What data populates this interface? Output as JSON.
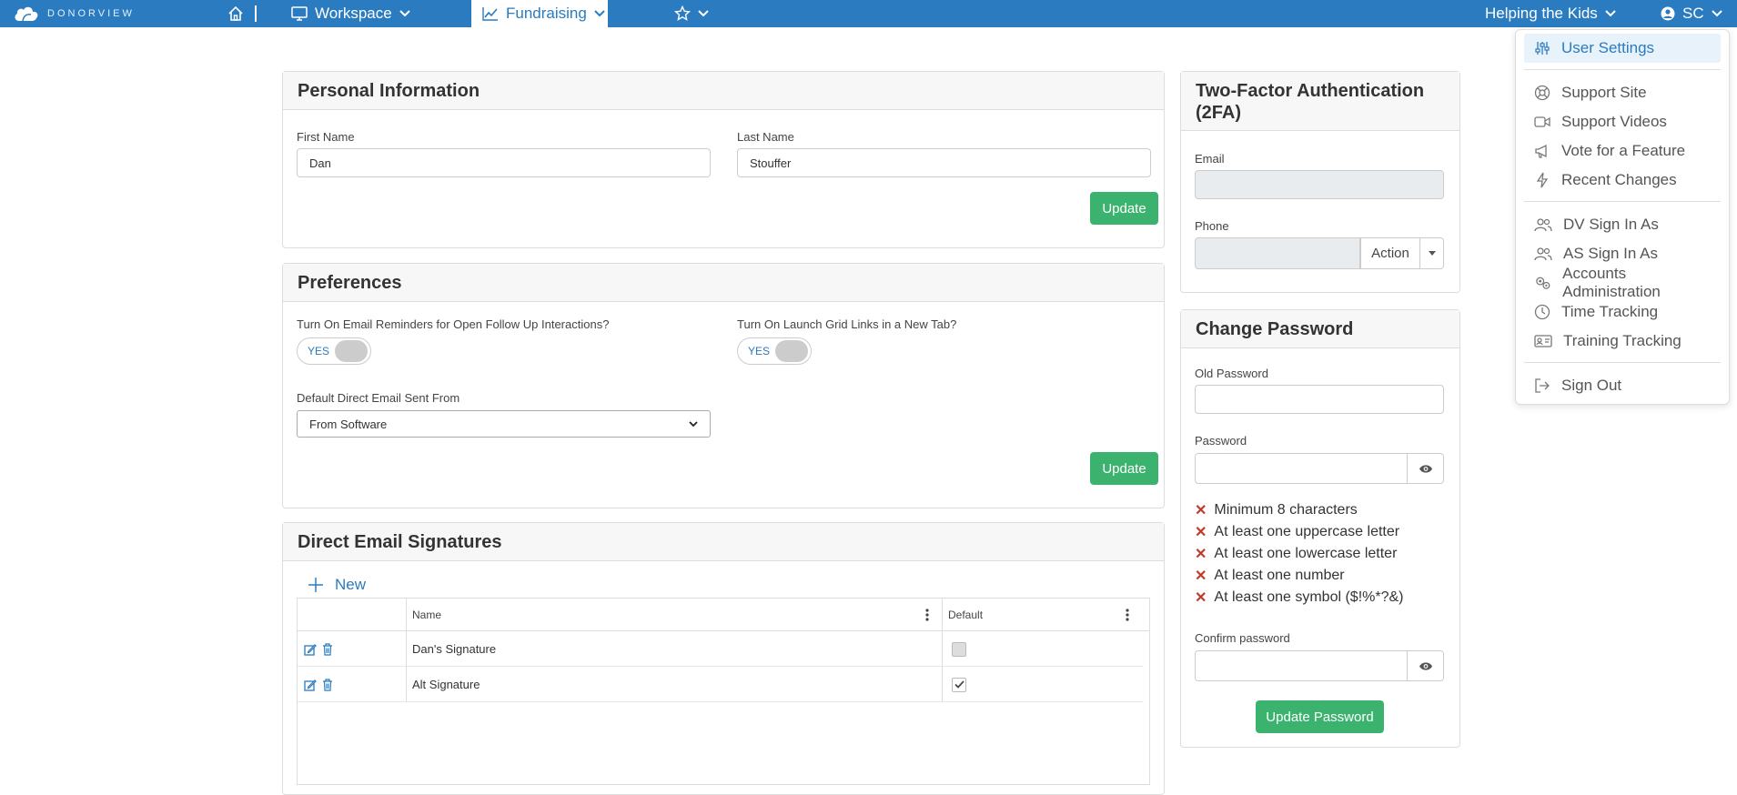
{
  "nav": {
    "brand": "DONORVIEW",
    "workspace": "Workspace",
    "fundraising": "Fundraising",
    "org": "Helping the Kids",
    "user": "SC"
  },
  "menu": {
    "items": [
      {
        "label": "User Settings",
        "icon": "sliders-icon"
      },
      {
        "label": "Support Site",
        "icon": "lifebuoy-icon"
      },
      {
        "label": "Support Videos",
        "icon": "video-icon"
      },
      {
        "label": "Vote for a Feature",
        "icon": "megaphone-icon"
      },
      {
        "label": "Recent Changes",
        "icon": "lightning-icon"
      },
      {
        "label": "DV Sign In As",
        "icon": "users-icon"
      },
      {
        "label": "AS Sign In As",
        "icon": "users-icon"
      },
      {
        "label": "Accounts Administration",
        "icon": "gears-icon"
      },
      {
        "label": "Time Tracking",
        "icon": "clock-icon"
      },
      {
        "label": "Training Tracking",
        "icon": "id-card-icon"
      },
      {
        "label": "Sign Out",
        "icon": "sign-out-icon"
      }
    ]
  },
  "personal": {
    "title": "Personal Information",
    "first_label": "First Name",
    "first_value": "Dan",
    "last_label": "Last Name",
    "last_value": "Stouffer",
    "update": "Update"
  },
  "prefs": {
    "title": "Preferences",
    "reminders_label": "Turn On Email Reminders for Open Follow Up Interactions?",
    "reminders_toggle": "YES",
    "grid_label": "Turn On Launch Grid Links in a New Tab?",
    "grid_toggle": "YES",
    "email_from_label": "Default Direct Email Sent From",
    "email_from_value": "From Software",
    "update": "Update"
  },
  "signatures": {
    "title": "Direct Email Signatures",
    "new": "New",
    "col_name": "Name",
    "col_default": "Default",
    "rows": [
      {
        "name": "Dan's Signature",
        "default": false
      },
      {
        "name": "Alt Signature",
        "default": true
      }
    ]
  },
  "twofa": {
    "title_line1": "Two-Factor Authentication",
    "title_line2": "(2FA)",
    "email_label": "Email",
    "phone_label": "Phone",
    "action": "Action"
  },
  "password": {
    "title": "Change Password",
    "old_label": "Old Password",
    "new_label": "Password",
    "requirements": [
      "Minimum 8 characters",
      "At least one uppercase letter",
      "At least one lowercase letter",
      "At least one number",
      "At least one symbol ($!%*?&)"
    ],
    "confirm_label": "Confirm password",
    "update": "Update Password"
  },
  "colors": {
    "nav": "#2a7bbf",
    "button": "#3bb36f",
    "error": "#c0392b"
  }
}
